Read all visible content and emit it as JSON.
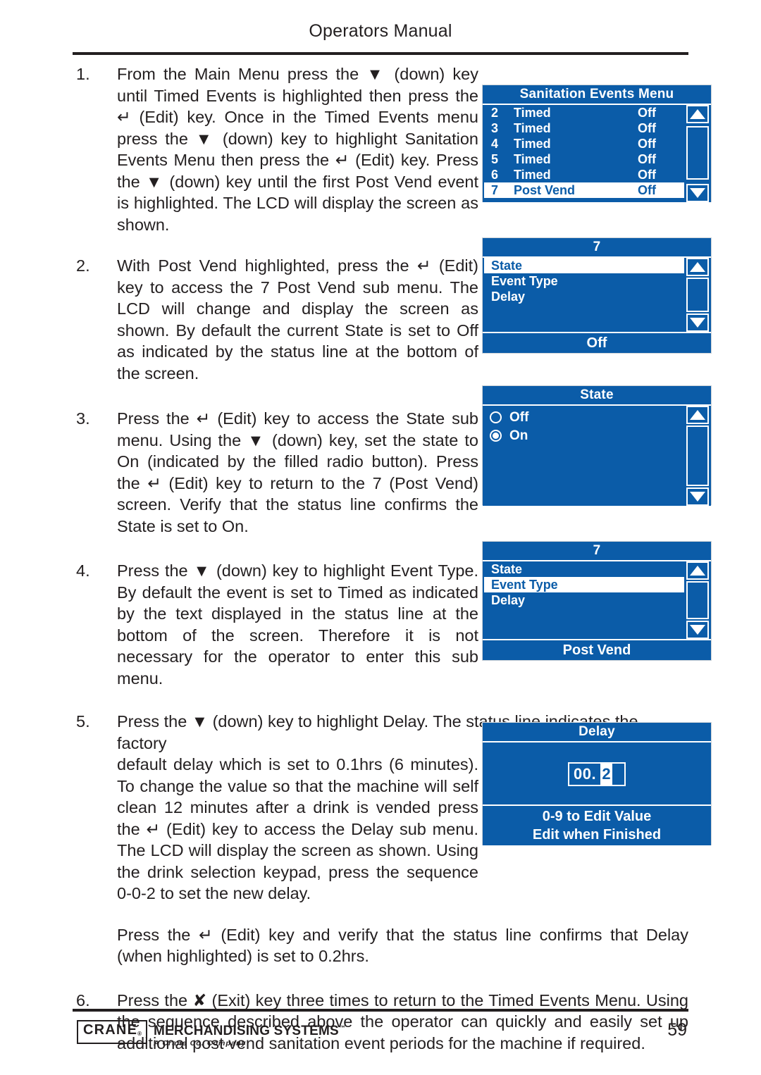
{
  "header": {
    "title": "Operators Manual"
  },
  "steps": [
    {
      "num": "1.",
      "text": "From the Main Menu press the ▼ (down) key until Timed Events is highlighted then press the ↵ (Edit) key. Once in the Timed Events menu press the ▼ (down) key to highlight Sanitation Events Menu then press the ↵ (Edit) key. Press the ▼ (down) key until the first Post Vend event is highlighted. The LCD will display the screen as shown."
    },
    {
      "num": "2.",
      "text": "With Post Vend highlighted, press the ↵ (Edit) key to access the 7 Post Vend sub menu. The LCD will change and display the screen as shown. By default the current State is set to Off as indicated by the status line at the bottom of the screen."
    },
    {
      "num": "3.",
      "text": "Press the ↵ (Edit) key to access the State sub menu. Using the ▼ (down) key, set the state to On (indicated by the filled radio button). Press the ↵ (Edit) key to return to the 7 (Post Vend) screen. Verify that the status line confirms the State is set to On."
    },
    {
      "num": "4.",
      "text": "Press the ▼ (down) key to highlight Event Type. By default the event is set to Timed as indicated by the text displayed in the status line at the bottom of the screen. Therefore it is not necessary for the operator to enter this sub menu."
    },
    {
      "num": "5.",
      "text_line1": "Press the ▼ (down) key to highlight Delay. The status line indicates the factory",
      "text_rest": "default delay which is set to 0.1hrs (6 minutes). To change the value so that the machine will self clean 12 minutes after a drink is vended press the ↵ (Edit) key to access the Delay sub menu. The LCD will display the screen as shown. Using the drink selection keypad, press the sequence 0-0-2 to set the new delay."
    },
    {
      "num": "",
      "text": "Press the ↵ (Edit) key and verify that the status line confirms that Delay (when highlighted) is set to 0.2hrs."
    },
    {
      "num": "6.",
      "text": "Press the ✘ (Exit) key three times to return to the Timed Events Menu. Using the sequence described above the operator can quickly and easily set up additional post vend sanitation event periods for the machine if required."
    }
  ],
  "lcd_screens": [
    {
      "id": "sanitation-events-menu",
      "title": "Sanitation Events Menu",
      "rows": [
        {
          "index": "2",
          "name": "Timed",
          "value": "Off",
          "selected": false
        },
        {
          "index": "3",
          "name": "Timed",
          "value": "Off",
          "selected": false
        },
        {
          "index": "4",
          "name": "Timed",
          "value": "Off",
          "selected": false
        },
        {
          "index": "5",
          "name": "Timed",
          "value": "Off",
          "selected": false
        },
        {
          "index": "6",
          "name": "Timed",
          "value": "Off",
          "selected": false
        },
        {
          "index": "7",
          "name": "Post Vend",
          "value": "Off",
          "selected": true
        }
      ],
      "scroll_up_icon": "triangle-up-icon",
      "scroll_down_icon": "triangle-down-icon"
    },
    {
      "id": "post-vend-submenu-state",
      "title": "7",
      "items": [
        {
          "label": "State",
          "selected": true
        },
        {
          "label": "Event Type",
          "selected": false
        },
        {
          "label": "Delay",
          "selected": false
        }
      ],
      "status": "Off"
    },
    {
      "id": "state-submenu",
      "title": "State",
      "options": [
        {
          "label": "Off",
          "checked": false
        },
        {
          "label": "On",
          "checked": true
        }
      ]
    },
    {
      "id": "post-vend-submenu-event-type",
      "title": "7",
      "items": [
        {
          "label": "State",
          "selected": false
        },
        {
          "label": "Event Type",
          "selected": true
        },
        {
          "label": "Delay",
          "selected": false
        }
      ],
      "status": "Post Vend"
    },
    {
      "id": "delay-submenu",
      "title": "Delay",
      "value_prefix": "00.",
      "value_cursor_digit": "2",
      "status_line1": "0-9 to Edit Value",
      "status_line2": "Edit when Finished"
    }
  ],
  "footer": {
    "logo_box": "CRANE",
    "logo_registered": "®",
    "logo_main": "MERCHANDISING SYSTEMS",
    "logo_tm": "™",
    "logo_sub": "A Crane Co. Company",
    "page_number": "59"
  },
  "colors": {
    "lcd_blue": "#0b5ca8",
    "lcd_white": "#ffffff",
    "ink": "#231f20"
  }
}
